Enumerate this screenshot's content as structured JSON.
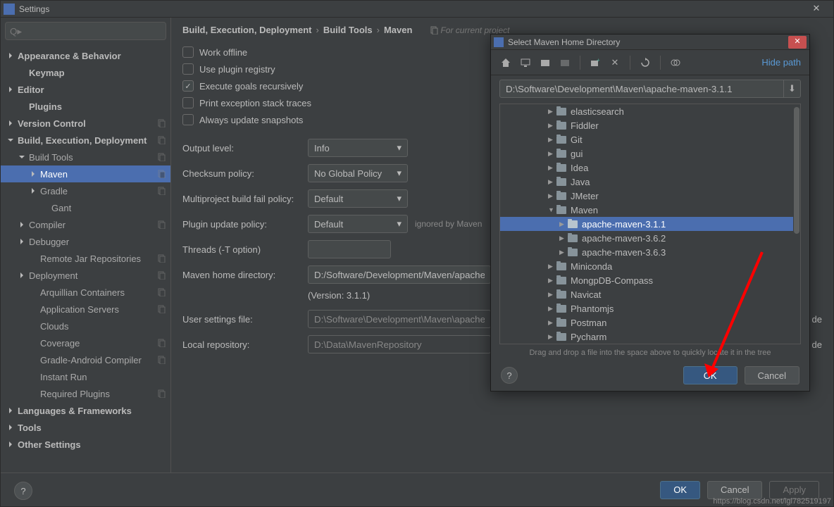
{
  "settings": {
    "title": "Settings",
    "search_placeholder": "Q▸",
    "tree": [
      {
        "label": "Appearance & Behavior",
        "bold": true,
        "indent": 0,
        "arrow": "right"
      },
      {
        "label": "Keymap",
        "bold": true,
        "indent": 1
      },
      {
        "label": "Editor",
        "bold": true,
        "indent": 0,
        "arrow": "right"
      },
      {
        "label": "Plugins",
        "bold": true,
        "indent": 1
      },
      {
        "label": "Version Control",
        "bold": true,
        "indent": 0,
        "arrow": "right",
        "copy": true
      },
      {
        "label": "Build, Execution, Deployment",
        "bold": true,
        "indent": 0,
        "arrow": "down",
        "copy": true
      },
      {
        "label": "Build Tools",
        "bold": false,
        "indent": 1,
        "arrow": "down",
        "copy": true
      },
      {
        "label": "Maven",
        "bold": false,
        "indent": 2,
        "arrow": "right",
        "selected": true,
        "copy": true
      },
      {
        "label": "Gradle",
        "bold": false,
        "indent": 2,
        "arrow": "right",
        "copy": true
      },
      {
        "label": "Gant",
        "bold": false,
        "indent": 3
      },
      {
        "label": "Compiler",
        "bold": false,
        "indent": 1,
        "arrow": "right",
        "copy": true
      },
      {
        "label": "Debugger",
        "bold": false,
        "indent": 1,
        "arrow": "right"
      },
      {
        "label": "Remote Jar Repositories",
        "bold": false,
        "indent": 2,
        "copy": true
      },
      {
        "label": "Deployment",
        "bold": false,
        "indent": 1,
        "arrow": "right",
        "copy": true
      },
      {
        "label": "Arquillian Containers",
        "bold": false,
        "indent": 2,
        "copy": true
      },
      {
        "label": "Application Servers",
        "bold": false,
        "indent": 2,
        "copy": true
      },
      {
        "label": "Clouds",
        "bold": false,
        "indent": 2
      },
      {
        "label": "Coverage",
        "bold": false,
        "indent": 2,
        "copy": true
      },
      {
        "label": "Gradle-Android Compiler",
        "bold": false,
        "indent": 2,
        "copy": true
      },
      {
        "label": "Instant Run",
        "bold": false,
        "indent": 2
      },
      {
        "label": "Required Plugins",
        "bold": false,
        "indent": 2,
        "copy": true
      },
      {
        "label": "Languages & Frameworks",
        "bold": true,
        "indent": 0,
        "arrow": "right"
      },
      {
        "label": "Tools",
        "bold": true,
        "indent": 0,
        "arrow": "right"
      },
      {
        "label": "Other Settings",
        "bold": true,
        "indent": 0,
        "arrow": "right"
      }
    ],
    "breadcrumb": [
      "Build, Execution, Deployment",
      "Build Tools",
      "Maven"
    ],
    "breadcrumb_note": "For current project",
    "checks": [
      {
        "label": "Work offline",
        "checked": false
      },
      {
        "label": "Use plugin registry",
        "checked": false
      },
      {
        "label": "Execute goals recursively",
        "checked": true
      },
      {
        "label": "Print exception stack traces",
        "checked": false
      },
      {
        "label": "Always update snapshots",
        "checked": false
      }
    ],
    "output_level_label": "Output level:",
    "output_level_value": "Info",
    "checksum_label": "Checksum policy:",
    "checksum_value": "No Global Policy",
    "multiproject_label": "Multiproject build fail policy:",
    "multiproject_value": "Default",
    "plugin_update_label": "Plugin update policy:",
    "plugin_update_value": "Default",
    "plugin_update_note": "ignored by Maven",
    "threads_label": "Threads (-T option)",
    "threads_value": "",
    "maven_home_label": "Maven home directory:",
    "maven_home_value": "D:/Software/Development/Maven/apache-ma",
    "version_text": "(Version: 3.1.1)",
    "user_settings_label": "User settings file:",
    "user_settings_value": "D:\\Software\\Development\\Maven\\apache-ma",
    "user_settings_suffix": "de",
    "local_repo_label": "Local repository:",
    "local_repo_value": "D:\\Data\\MavenRepository",
    "local_repo_suffix": "de",
    "ok_btn": "OK",
    "cancel_btn": "Cancel",
    "apply_btn": "Apply"
  },
  "dialog": {
    "title": "Select Maven Home Directory",
    "hide_path": "Hide path",
    "path": "D:\\Software\\Development\\Maven\\apache-maven-3.1.1",
    "tree": [
      {
        "label": "elasticsearch",
        "indent": 4,
        "arrow": "right"
      },
      {
        "label": "Fiddler",
        "indent": 4,
        "arrow": "right"
      },
      {
        "label": "Git",
        "indent": 4,
        "arrow": "right"
      },
      {
        "label": "gui",
        "indent": 4,
        "arrow": "right"
      },
      {
        "label": "Idea",
        "indent": 4,
        "arrow": "right"
      },
      {
        "label": "Java",
        "indent": 4,
        "arrow": "right"
      },
      {
        "label": "JMeter",
        "indent": 4,
        "arrow": "right"
      },
      {
        "label": "Maven",
        "indent": 4,
        "arrow": "down"
      },
      {
        "label": "apache-maven-3.1.1",
        "indent": 5,
        "arrow": "right",
        "selected": true
      },
      {
        "label": "apache-maven-3.6.2",
        "indent": 5,
        "arrow": "right"
      },
      {
        "label": "apache-maven-3.6.3",
        "indent": 5,
        "arrow": "right"
      },
      {
        "label": "Miniconda",
        "indent": 4,
        "arrow": "right"
      },
      {
        "label": "MongpDB-Compass",
        "indent": 4,
        "arrow": "right"
      },
      {
        "label": "Navicat",
        "indent": 4,
        "arrow": "right"
      },
      {
        "label": "Phantomjs",
        "indent": 4,
        "arrow": "right"
      },
      {
        "label": "Postman",
        "indent": 4,
        "arrow": "right"
      },
      {
        "label": "Pycharm",
        "indent": 4,
        "arrow": "right"
      }
    ],
    "hint": "Drag and drop a file into the space above to quickly locate it in the tree",
    "ok_btn": "OK",
    "cancel_btn": "Cancel"
  },
  "watermark": "https://blog.csdn.net/lgl782519197"
}
